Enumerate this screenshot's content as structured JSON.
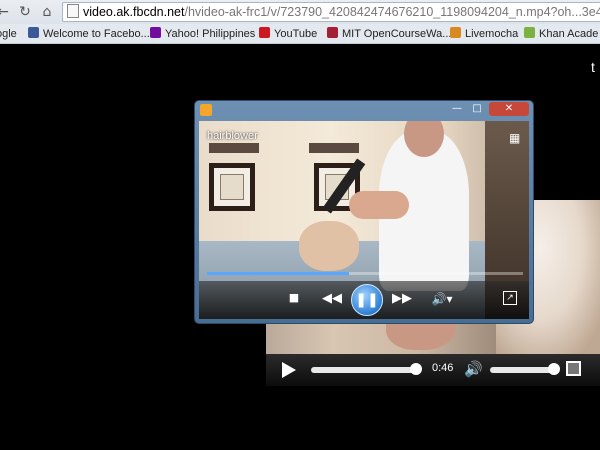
{
  "browser": {
    "address": {
      "host": "video.ak.fbcdn.net",
      "path": "/hvideo-ak-frc1/v/723790_420842474676210_1198094204_n.mp4?oh...3e4"
    },
    "bookmarks": [
      {
        "label": "ogle",
        "icon": "google-icon",
        "color": "#4a7bd8"
      },
      {
        "label": "Welcome to Facebo...",
        "icon": "facebook-icon",
        "color": "#3b5998"
      },
      {
        "label": "Yahoo! Philippines",
        "icon": "yahoo-icon",
        "color": "#720e9e"
      },
      {
        "label": "YouTube",
        "icon": "youtube-icon",
        "color": "#cc181e"
      },
      {
        "label": "MIT OpenCourseWa...",
        "icon": "mit-icon",
        "color": "#a31f34"
      },
      {
        "label": "Livemocha",
        "icon": "livemocha-icon",
        "color": "#d98a1f"
      },
      {
        "label": "Khan Acade",
        "icon": "khan-icon",
        "color": "#7bb13e"
      }
    ]
  },
  "page_player": {
    "time": "0:46",
    "seek_progress": 0.9,
    "volume_level": 0.85
  },
  "wmp": {
    "filename": "hairblower",
    "seek_progress": 0.45,
    "state": "playing",
    "accent_color": "#2e7fd4"
  },
  "corner_char": "t"
}
